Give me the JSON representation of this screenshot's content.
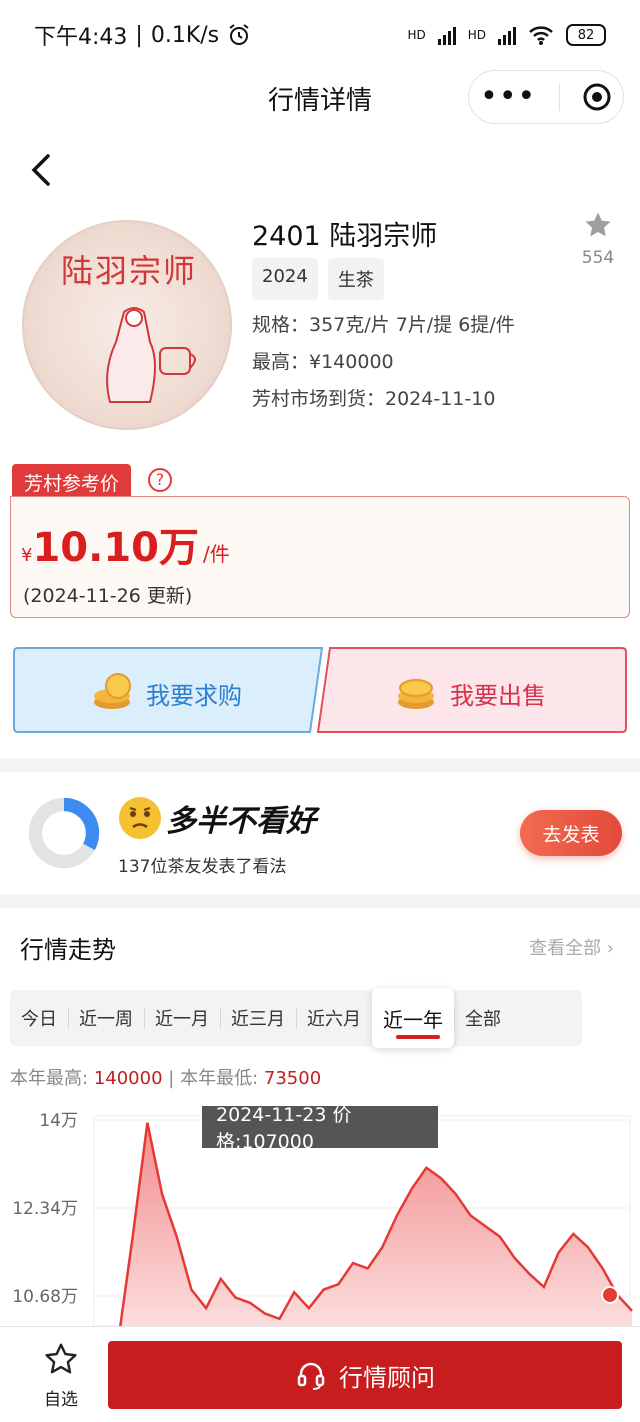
{
  "status_bar": {
    "time": "下午4:43",
    "speed": "0.1K/s",
    "battery": "82",
    "network_label": "HD"
  },
  "nav": {
    "title": "行情详情"
  },
  "product": {
    "cake_title": "陆羽宗师",
    "name": "2401 陆羽宗师",
    "tags": [
      "2024",
      "生茶"
    ],
    "spec": "规格：357克/片 7片/提 6提/件",
    "highest": "最高：¥140000",
    "arrival": "芳村市场到货：2024-11-10",
    "star_count": "554"
  },
  "reference": {
    "tab_label": "芳村参考价",
    "help": "?",
    "currency": "¥",
    "price": "10.10万",
    "unit": "/件",
    "updated": "(2024-11-26 更新)"
  },
  "actions": {
    "buy": "我要求购",
    "sell": "我要出售"
  },
  "opinion": {
    "title": "多半不看好",
    "subtitle": "137位茶友发表了看法",
    "button": "去发表",
    "bullish_fraction": 0.33
  },
  "trend": {
    "title": "行情走势",
    "view_all": "查看全部 ›",
    "ranges": [
      "今日",
      "近一周",
      "近一月",
      "近三月",
      "近六月",
      "近一年",
      "全部"
    ],
    "active_range": "近一年",
    "year_high_label": "本年最高:",
    "year_high": "140000",
    "year_low_label": "本年最低:",
    "year_low": "73500",
    "divider": "|",
    "tooltip": "2024-11-23 价格:107000"
  },
  "chart_data": {
    "type": "area",
    "y_ticks": [
      "14万",
      "12.34万",
      "10.68万"
    ],
    "y_tick_values": [
      140000,
      123400,
      106800
    ],
    "ylim_visible": [
      101000,
      140000
    ],
    "series": [
      {
        "values": [
          98000,
          118000,
          139500,
          126000,
          118000,
          108000,
          104500,
          110000,
          106500,
          105500,
          103500,
          102500,
          107500,
          104500,
          108000,
          109000,
          113000,
          112000,
          116000,
          122000,
          127000,
          131000,
          129000,
          126000,
          122000,
          120000,
          118000,
          114000,
          111000,
          108500,
          115000,
          118500,
          116000,
          112000,
          107000,
          104000
        ]
      }
    ],
    "highlight": {
      "date": "2024-11-23",
      "value": 107000
    },
    "colors": {
      "line": "#e53935",
      "fill_top": "#f28c8c",
      "fill_bottom": "#fde4e4"
    }
  },
  "bottom": {
    "fav_label": "自选",
    "advisor": "行情顾问"
  }
}
